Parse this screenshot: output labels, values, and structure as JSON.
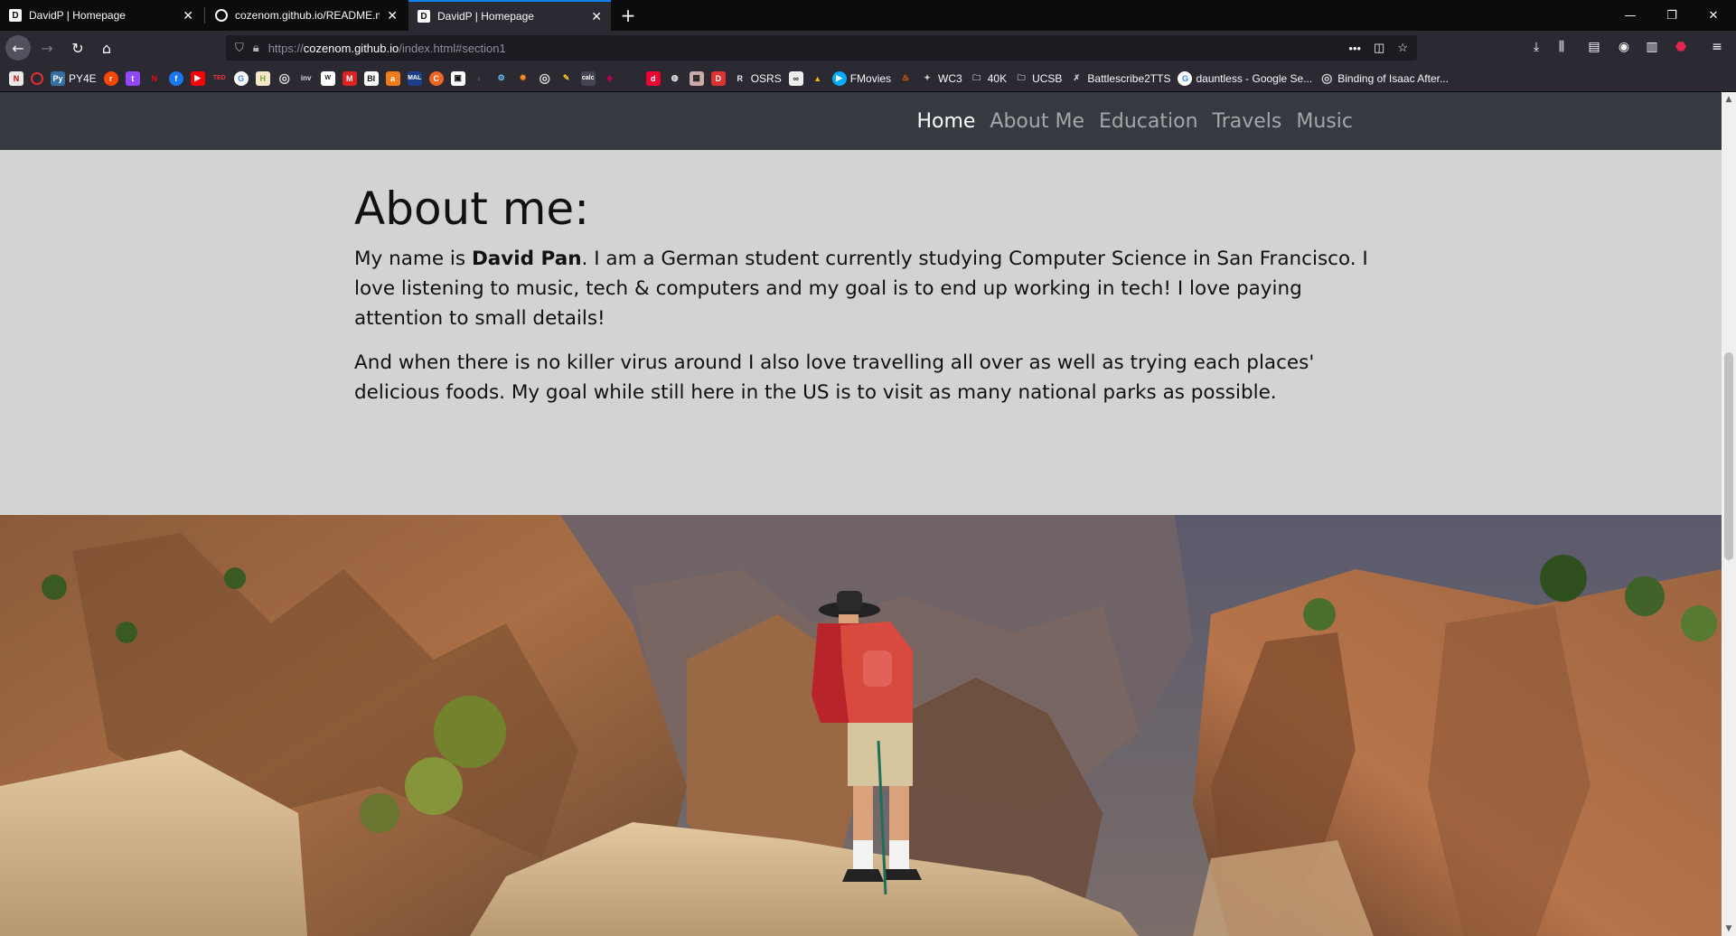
{
  "browser": {
    "tabs": [
      {
        "title": "DavidP | Homepage",
        "icon": "D"
      },
      {
        "title": "cozenom.github.io/README.m",
        "icon": "github-icon"
      },
      {
        "title": "DavidP | Homepage",
        "icon": "D"
      }
    ],
    "url_prefix": "https://",
    "url_host": "cozenom.github.io",
    "url_path": "/index.html#section1"
  },
  "bookmarks": {
    "items": [
      {
        "label": "PY4E"
      },
      {
        "label": "OSRS"
      },
      {
        "label": "FMovies"
      },
      {
        "label": "WC3"
      },
      {
        "label": "40K"
      },
      {
        "label": "UCSB"
      },
      {
        "label": "Battlescribe2TTS"
      },
      {
        "label": "dauntless - Google Se..."
      },
      {
        "label": "Binding of Isaac After..."
      }
    ]
  },
  "site": {
    "nav": {
      "home": "Home",
      "about": "About Me",
      "education": "Education",
      "travels": "Travels",
      "music": "Music"
    },
    "about": {
      "heading": "About me:",
      "p1_before": "My name is ",
      "p1_name": "David Pan",
      "p1_after": ". I am a German student currently studying Computer Science in San Francisco. I love listening to music, tech & computers and my goal is to end up working in tech! I love paying attention to small details!",
      "p2": "And when there is no killer virus around I also love travelling all over as well as trying each places' delicious foods. My goal while still here in the US is to visit as many national parks as possible."
    }
  },
  "colors": {
    "site_nav_bg": "#343a40",
    "about_bg": "#d3d3d3",
    "tab_accent": "#0a84ff"
  }
}
